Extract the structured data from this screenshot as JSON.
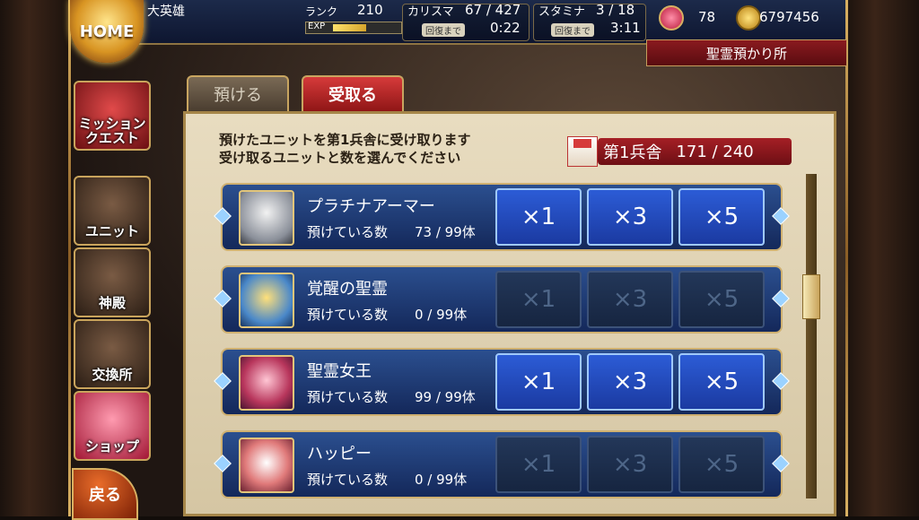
{
  "header": {
    "home_label": "HOME",
    "player_name": "大英雄",
    "rank_label": "ランク",
    "rank_value": "210",
    "exp_label": "EXP",
    "exp_progress": 0.5,
    "charisma_label": "カリスマ",
    "charisma_value": "67 / 427",
    "charisma_recover_label": "回復まで",
    "charisma_recover_time": "0:22",
    "stamina_label": "スタミナ",
    "stamina_value": "3 / 18",
    "stamina_recover_label": "回復まで",
    "stamina_recover_time": "3:11",
    "crystals": "78",
    "gold": "6797456",
    "location": "聖霊預かり所"
  },
  "side_menu": [
    {
      "label": "ミッション クエスト"
    },
    {
      "label": "ユニット"
    },
    {
      "label": "神殿"
    },
    {
      "label": "交換所"
    },
    {
      "label": "ショップ"
    }
  ],
  "back_label": "戻る",
  "tabs": {
    "deposit": "預ける",
    "receive": "受取る"
  },
  "panel": {
    "instruction_1": "預けたユニットを第1兵舎に受け取ります",
    "instruction_2": "受け取るユニットと数を選んでください",
    "barracks_name": "第1兵舎",
    "barracks_count": "171 / 240"
  },
  "rows": [
    {
      "name": "プラチナアーマー",
      "held_label": "預けている数",
      "held": "73 / 99体",
      "x1": "×1",
      "x3": "×3",
      "x5": "×5"
    },
    {
      "name": "覚醒の聖霊",
      "held_label": "預けている数",
      "held": "0 / 99体",
      "x1": "×1",
      "x3": "×3",
      "x5": "×5"
    },
    {
      "name": "聖霊女王",
      "held_label": "預けている数",
      "held": "99 / 99体",
      "x1": "×1",
      "x3": "×3",
      "x5": "×5"
    },
    {
      "name": "ハッピー",
      "held_label": "預けている数",
      "held": "0 / 99体",
      "x1": "×1",
      "x3": "×3",
      "x5": "×5"
    }
  ]
}
